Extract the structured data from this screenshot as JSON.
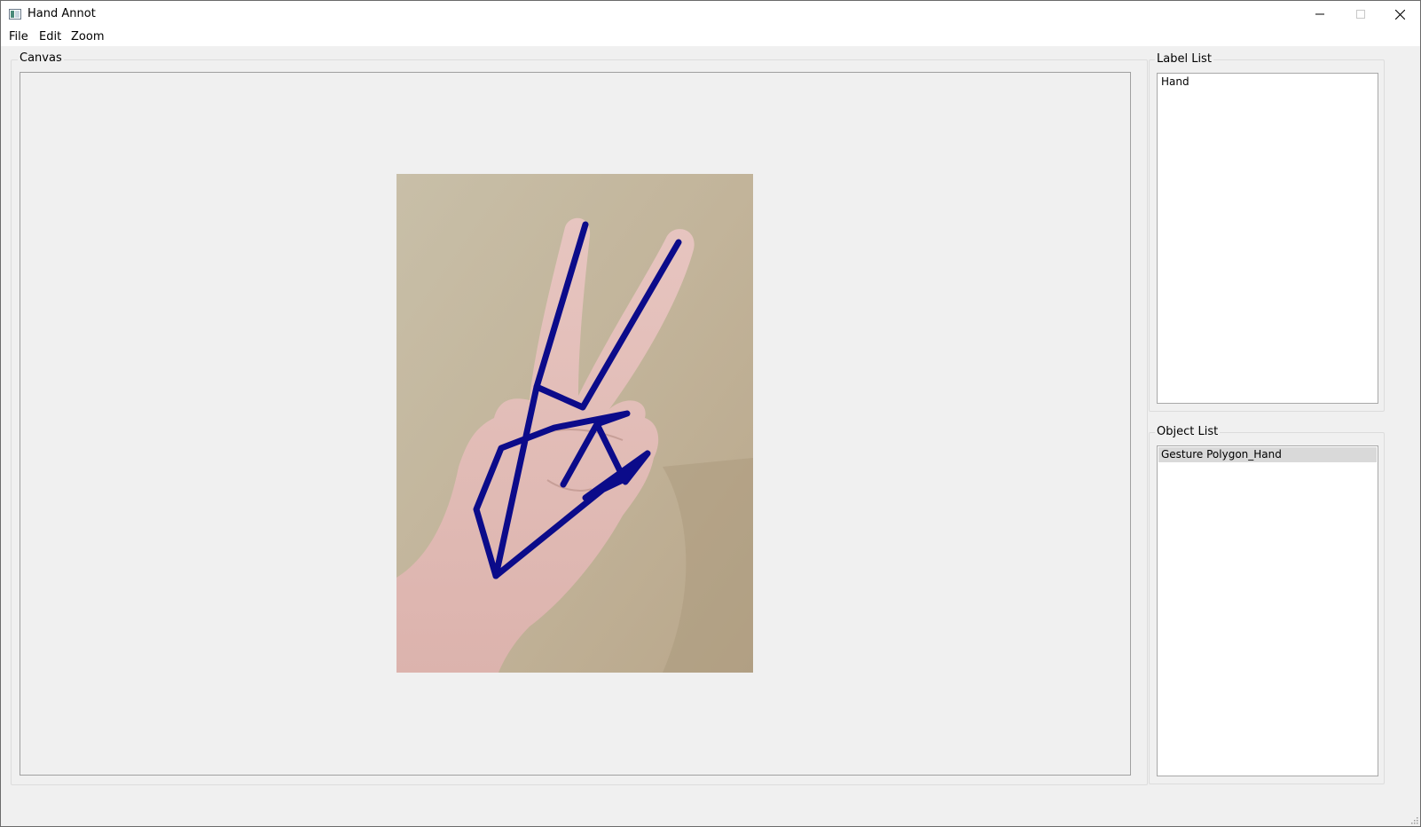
{
  "window": {
    "title": "Hand Annot",
    "icon": "app-window-icon",
    "controls": [
      "minimize-icon",
      "maximize-icon",
      "close-icon"
    ]
  },
  "menubar": {
    "items": [
      {
        "label": "File"
      },
      {
        "label": "Edit"
      },
      {
        "label": "Zoom"
      }
    ]
  },
  "canvas": {
    "group_title": "Canvas",
    "annotation_color": "#0b0b8a"
  },
  "label_list": {
    "group_title": "Label List",
    "items": [
      {
        "label": "Hand"
      }
    ]
  },
  "object_list": {
    "group_title": "Object List",
    "items": [
      {
        "label": "Gesture Polygon_Hand",
        "selected": true
      }
    ]
  }
}
